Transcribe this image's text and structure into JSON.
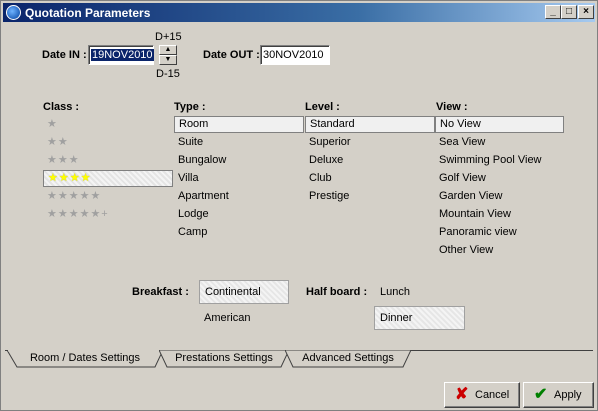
{
  "window": {
    "title": "Quotation Parameters"
  },
  "dates": {
    "date_in_label": "Date IN :",
    "date_in_value": "19NOV2010",
    "offset_up": "D+15",
    "offset_down": "D-15",
    "date_out_label": "Date OUT :",
    "date_out_value": "30NOV2010"
  },
  "columns": {
    "class": "Class :",
    "type": "Type :",
    "level": "Level :",
    "view": "View :"
  },
  "class_items": [
    {
      "stars": "★",
      "selected": false
    },
    {
      "stars": "★★",
      "selected": false
    },
    {
      "stars": "★★★",
      "selected": false
    },
    {
      "stars": "★★★★",
      "selected": true
    },
    {
      "stars": "★★★★★",
      "selected": false
    },
    {
      "stars": "★★★★★+",
      "selected": false
    }
  ],
  "type_items": [
    "Room",
    "Suite",
    "Bungalow",
    "Villa",
    "Apartment",
    "Lodge",
    "Camp"
  ],
  "type_selected": "Room",
  "level_items": [
    "Standard",
    "Superior",
    "Deluxe",
    "Club",
    "Prestige"
  ],
  "level_selected": "Standard",
  "view_items": [
    "No View",
    "Sea View",
    "Swimming Pool View",
    "Golf View",
    "Garden View",
    "Mountain View",
    "Panoramic view",
    "Other View"
  ],
  "view_selected": "No View",
  "meals": {
    "breakfast_label": "Breakfast :",
    "breakfast_options": [
      "Continental",
      "American"
    ],
    "breakfast_selected": "Continental",
    "halfboard_label": "Half board :",
    "halfboard_options": [
      "Lunch",
      "Dinner"
    ],
    "halfboard_selected": "Dinner"
  },
  "tabs": [
    {
      "label": "Room / Dates Settings",
      "active": true
    },
    {
      "label": "Prestations Settings",
      "active": false
    },
    {
      "label": "Advanced Settings",
      "active": false
    }
  ],
  "buttons": {
    "cancel": "Cancel",
    "apply": "Apply"
  },
  "colors": {
    "title_start": "#0a246a",
    "title_end": "#a6caf0",
    "face": "#d4d0c8",
    "star_on": "#ffff00",
    "star_off": "#a0a0a0",
    "cancel_icon": "#cc0000",
    "apply_icon": "#008000"
  },
  "icons": {
    "app": "app-icon",
    "minimize": "minimize-icon",
    "maximize": "maximize-icon",
    "close": "close-icon",
    "cancel": "x-icon",
    "apply": "checkmark-icon"
  }
}
